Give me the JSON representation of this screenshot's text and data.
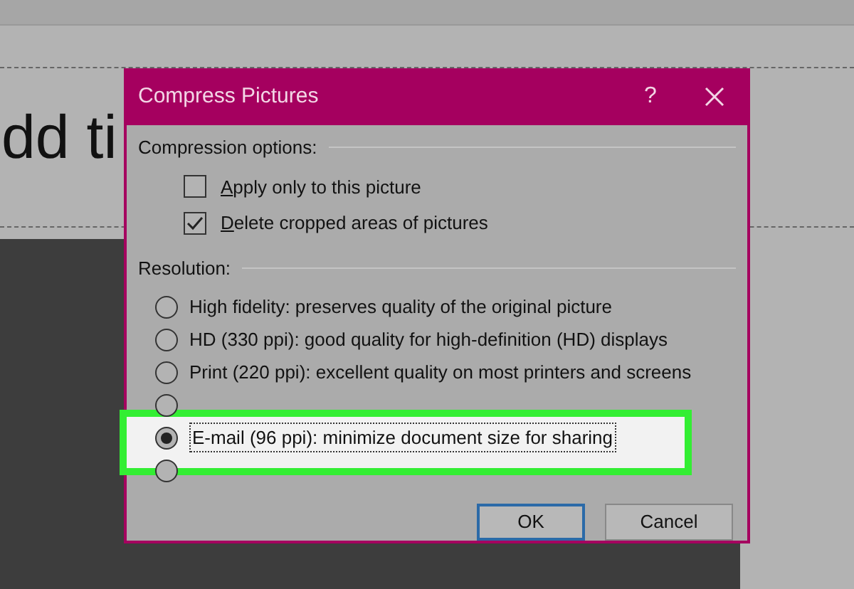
{
  "slide": {
    "title": "dd ti"
  },
  "dialog": {
    "title": "Compress Pictures",
    "help": "?",
    "compression": {
      "label": "Compression options:",
      "options": [
        {
          "label": "Apply only to this picture",
          "checked": false
        },
        {
          "label": "Delete cropped areas of pictures",
          "checked": true
        }
      ]
    },
    "resolution": {
      "label": "Resolution:",
      "options": [
        {
          "label": "High fidelity: preserves quality of the original picture",
          "selected": false,
          "highlighted": false
        },
        {
          "label": "HD (330 ppi): good quality for high-definition (HD) displays",
          "selected": false,
          "highlighted": false
        },
        {
          "label": "Print (220 ppi): excellent quality on most printers and screens",
          "selected": false,
          "highlighted": false
        },
        {
          "selected": false,
          "highlighted": false
        },
        {
          "label": "E-mail (96 ppi): minimize document size for sharing",
          "selected": true,
          "highlighted": true
        },
        {
          "selected": false,
          "highlighted": false
        }
      ]
    },
    "buttons": [
      {
        "label": "OK",
        "default": true
      },
      {
        "label": "Cancel",
        "default": false
      }
    ]
  }
}
